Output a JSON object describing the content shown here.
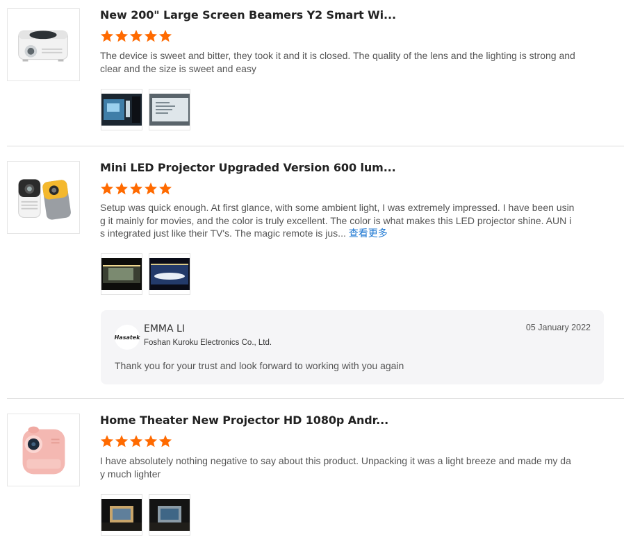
{
  "reviews": [
    {
      "title": "New 200\" Large Screen Beamers Y2 Smart Wi...",
      "stars": 5,
      "text": "The device is sweet and bitter, they took it and it is closed. The quality of the lens and the lighting is strong and clear and the size is sweet and easy",
      "photos": [
        "photo-screen-1",
        "photo-screen-2"
      ]
    },
    {
      "title": "Mini LED Projector Upgraded Version 600 lum...",
      "stars": 5,
      "text": "Setup was quick enough. At first glance, with some ambient light, I was extremely impressed. I have been using it mainly for movies, and the color is truly excellent. The color is what makes this LED projector shine. AUN is integrated just like their TV's. The magic remote is jus...",
      "more_label": "查看更多",
      "photos": [
        "photo-screen-1",
        "photo-screen-2"
      ],
      "reply": {
        "logo_text": "Hasatek",
        "name": "EMMA LI",
        "company": "Foshan Kuroku Electronics Co., Ltd.",
        "date": "05 January 2022",
        "text": "Thank you for your trust and look forward to working with you again"
      }
    },
    {
      "title": "Home Theater New Projector HD 1080p Andr...",
      "stars": 5,
      "text": "I have absolutely nothing negative to say about this product. Unpacking it was a light breeze and made my day much lighter",
      "photos": [
        "photo-screen-1",
        "photo-screen-2"
      ]
    }
  ],
  "colors": {
    "star": "#ff6a00",
    "link": "#1a76d2",
    "separator": "#dcdcdc",
    "reply_bg": "#f5f5f7"
  }
}
